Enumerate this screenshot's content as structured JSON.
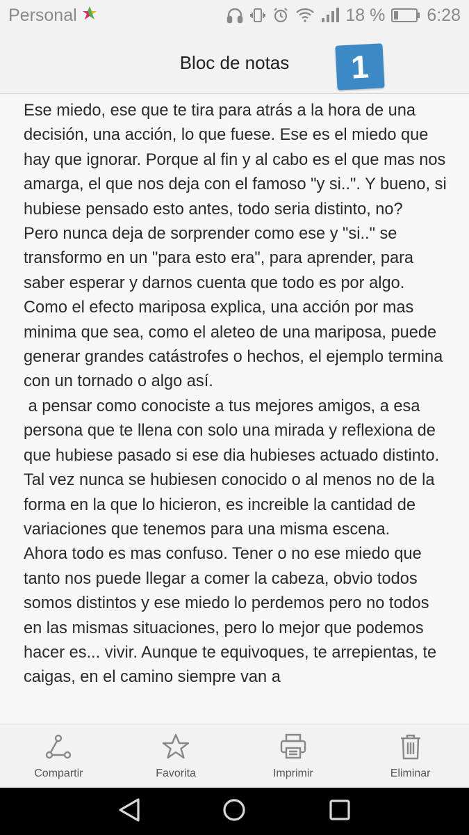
{
  "status_bar": {
    "carrier": "Personal",
    "battery": "18 %",
    "time": "6:28",
    "icons": [
      "app-icon",
      "headphones-icon",
      "vibrate-icon",
      "alarm-icon",
      "wifi-icon",
      "signal-icon",
      "battery-icon"
    ]
  },
  "header": {
    "title": "Bloc de notas",
    "badge": "1",
    "badge_color": "#3b8ac6"
  },
  "note": {
    "text": "Ese miedo, ese que te tira para atrás a la hora de una decisión, una acción, lo que fuese. Ese es el miedo que hay que ignorar. Porque al fin y al cabo es el que mas nos amarga, el que nos deja con el famoso \"y si..\". Y bueno, si hubiese pensado esto antes, todo seria distinto, no?\nPero nunca deja de sorprender como ese y \"si..\" se transformo en un \"para esto era\", para aprender, para saber esperar y darnos cuenta que todo es por algo.\nComo el efecto mariposa explica, una acción por mas minima que sea, como el aleteo de una mariposa, puede generar grandes catástrofes o hechos, el ejemplo termina con un tornado o algo así.\n a pensar como conociste a tus mejores amigos, a esa persona que te llena con solo una mirada y reflexiona de que hubiese pasado si ese dia hubieses actuado distinto. Tal vez nunca se hubiesen conocido o al menos no de la forma en la que lo hicieron, es increible la cantidad de variaciones que tenemos para una misma escena.\nAhora todo es mas confuso. Tener o no ese miedo que tanto nos puede llegar a comer la cabeza, obvio todos somos distintos y ese miedo lo perdemos pero no todos en las mismas situaciones, pero lo mejor que podemos hacer es... vivir. Aunque te equivoques, te arrepientas, te caigas, en el camino siempre van a"
  },
  "toolbar": {
    "share": "Compartir",
    "favorite": "Favorita",
    "print": "Imprimir",
    "delete": "Eliminar"
  },
  "nav": {
    "icons": [
      "back-icon",
      "home-icon",
      "recents-icon"
    ]
  }
}
